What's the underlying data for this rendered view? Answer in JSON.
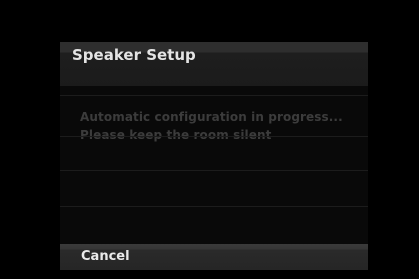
{
  "dialog": {
    "title": "Speaker Setup",
    "message_line1": "Automatic configuration in progress...",
    "message_line2": "Please keep the room silent",
    "cancel_label": "Cancel"
  },
  "colors": {
    "background": "#000000",
    "panel": "#090909",
    "title_bar": "#1e1e1e",
    "title_text": "#e4e4e4",
    "message_text": "#3c3c3c",
    "cancel_bar": "#2a2a2a",
    "cancel_text": "#eaeaea"
  }
}
